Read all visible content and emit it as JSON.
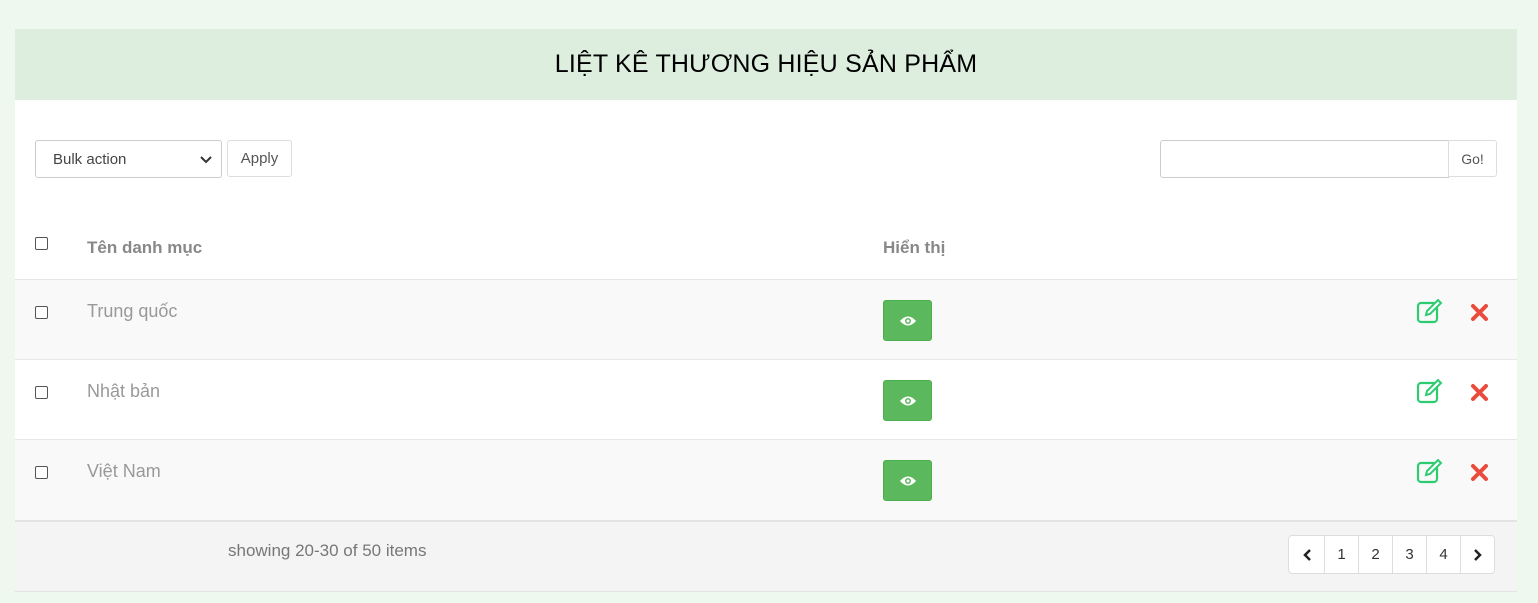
{
  "page": {
    "title": "LIỆT KÊ THƯƠNG HIỆU SẢN PHẨM"
  },
  "toolbar": {
    "bulk_action": {
      "selected": "Bulk action"
    },
    "apply_label": "Apply",
    "search": {
      "value": "",
      "placeholder": ""
    },
    "go_label": "Go!"
  },
  "table": {
    "columns": [
      "Tên danh mục",
      "Hiển thị"
    ],
    "rows": [
      {
        "name": "Trung quốc",
        "display_icon": "eye-icon"
      },
      {
        "name": "Nhật bản",
        "display_icon": "eye-icon"
      },
      {
        "name": "Việt Nam",
        "display_icon": "eye-icon"
      }
    ]
  },
  "footer": {
    "showing_text": "showing 20-30 of 50 items",
    "pages": [
      "1",
      "2",
      "3",
      "4"
    ]
  },
  "colors": {
    "background": "#eef8ee",
    "header_bg": "#ddeedf",
    "success": "#5cb85c",
    "danger": "#e74c3c",
    "edit_green": "#2ecc71"
  },
  "icons": [
    "chevron-down-icon",
    "eye-icon",
    "edit-icon",
    "delete-icon",
    "chevron-left-icon",
    "chevron-right-icon"
  ]
}
